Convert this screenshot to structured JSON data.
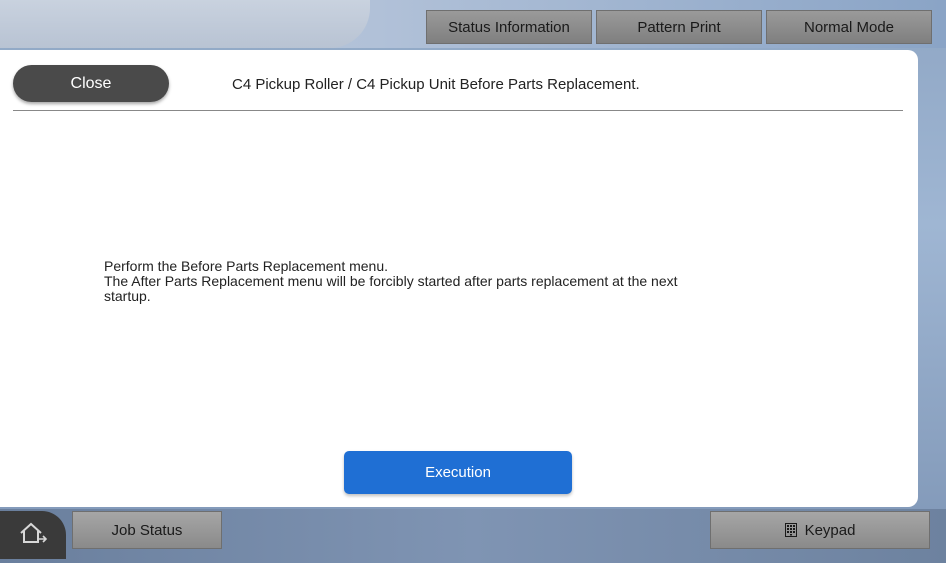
{
  "top_tabs": {
    "status": "Status Information",
    "pattern": "Pattern Print",
    "normal": "Normal Mode"
  },
  "dialog": {
    "close_label": "Close",
    "title": "C4 Pickup Roller / C4 Pickup Unit Before Parts Replacement.",
    "message_lines": [
      "Perform the Before Parts Replacement menu.",
      "The After Parts Replacement menu will be forcibly started after parts replacement at the next",
      "startup."
    ],
    "execute_label": "Execution"
  },
  "bottom": {
    "job_status": "Job Status",
    "keypad": "Keypad"
  },
  "colors": {
    "accent": "#1f6fd4",
    "close_button": "#4a4a4a"
  },
  "icons": [
    "home-icon",
    "keypad-icon"
  ]
}
